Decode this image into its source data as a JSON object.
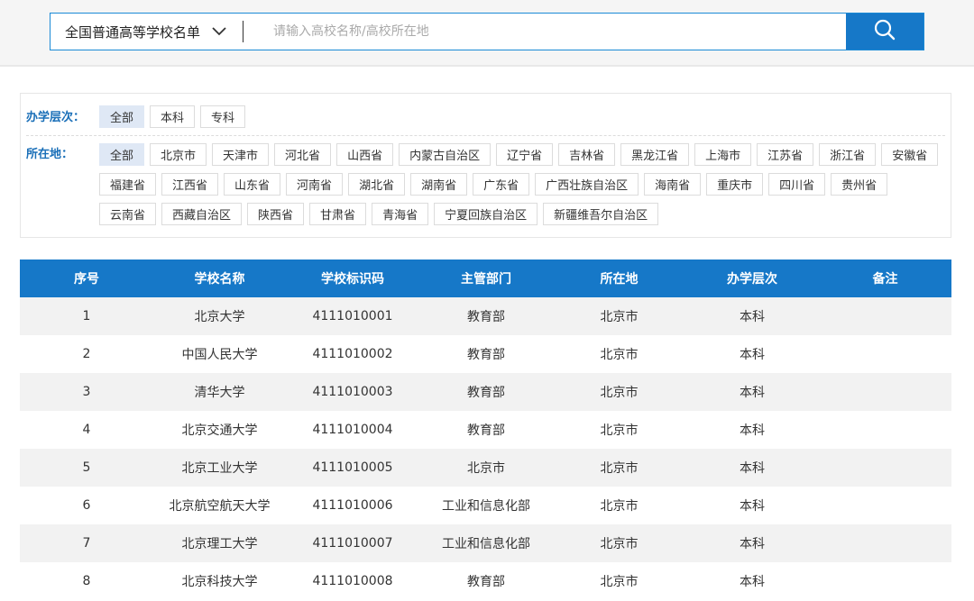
{
  "search": {
    "scope_label": "全国普通高等学校名单",
    "placeholder": "请输入高校名称/高校所在地",
    "value": ""
  },
  "filters": {
    "level": {
      "label": "办学层次：",
      "options": [
        "全部",
        "本科",
        "专科"
      ],
      "selected": "全部"
    },
    "location": {
      "label": "所在地：",
      "options": [
        "全部",
        "北京市",
        "天津市",
        "河北省",
        "山西省",
        "内蒙古自治区",
        "辽宁省",
        "吉林省",
        "黑龙江省",
        "上海市",
        "江苏省",
        "浙江省",
        "安徽省",
        "福建省",
        "江西省",
        "山东省",
        "河南省",
        "湖北省",
        "湖南省",
        "广东省",
        "广西壮族自治区",
        "海南省",
        "重庆市",
        "四川省",
        "贵州省",
        "云南省",
        "西藏自治区",
        "陕西省",
        "甘肃省",
        "青海省",
        "宁夏回族自治区",
        "新疆维吾尔自治区"
      ],
      "selected": "全部"
    }
  },
  "table": {
    "headers": [
      "序号",
      "学校名称",
      "学校标识码",
      "主管部门",
      "所在地",
      "办学层次",
      "备注"
    ],
    "rows": [
      [
        "1",
        "北京大学",
        "4111010001",
        "教育部",
        "北京市",
        "本科",
        ""
      ],
      [
        "2",
        "中国人民大学",
        "4111010002",
        "教育部",
        "北京市",
        "本科",
        ""
      ],
      [
        "3",
        "清华大学",
        "4111010003",
        "教育部",
        "北京市",
        "本科",
        ""
      ],
      [
        "4",
        "北京交通大学",
        "4111010004",
        "教育部",
        "北京市",
        "本科",
        ""
      ],
      [
        "5",
        "北京工业大学",
        "4111010005",
        "北京市",
        "北京市",
        "本科",
        ""
      ],
      [
        "6",
        "北京航空航天大学",
        "4111010006",
        "工业和信息化部",
        "北京市",
        "本科",
        ""
      ],
      [
        "7",
        "北京理工大学",
        "4111010007",
        "工业和信息化部",
        "北京市",
        "本科",
        ""
      ],
      [
        "8",
        "北京科技大学",
        "4111010008",
        "教育部",
        "北京市",
        "本科",
        ""
      ]
    ]
  },
  "colors": {
    "accent": "#1678c8",
    "label": "#1a6fb8",
    "chip_active": "#dfe8f5",
    "row_alt": "#f2f2f2"
  },
  "icons": {
    "search": "search-icon",
    "dropdown": "chevron-down-icon"
  }
}
